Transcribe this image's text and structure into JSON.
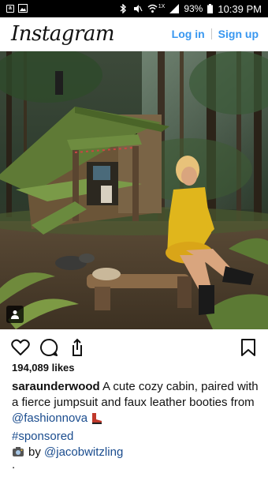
{
  "status_bar": {
    "battery": "93%",
    "time": "10:39 PM",
    "left_icons": [
      "notification-icon",
      "image-notification-icon"
    ],
    "right_icons": [
      "bluetooth-icon",
      "mute-icon",
      "wifi-icon",
      "signal-icon",
      "battery-icon"
    ],
    "signal_label": "1X"
  },
  "header": {
    "logo": "Instagram",
    "login": "Log in",
    "signup": "Sign up",
    "accent": "#3897f0"
  },
  "post": {
    "likes": "194,089 likes",
    "username": "saraunderwood",
    "caption_text": "A cute cozy cabin, paired with a fierce jumpsuit and faux leather booties from",
    "mention_brand": "@fashionnova",
    "hashtag": "#sponsored",
    "credit_prefix": "by",
    "credit_mention": "@jacobwitzling",
    "trailing": "."
  }
}
